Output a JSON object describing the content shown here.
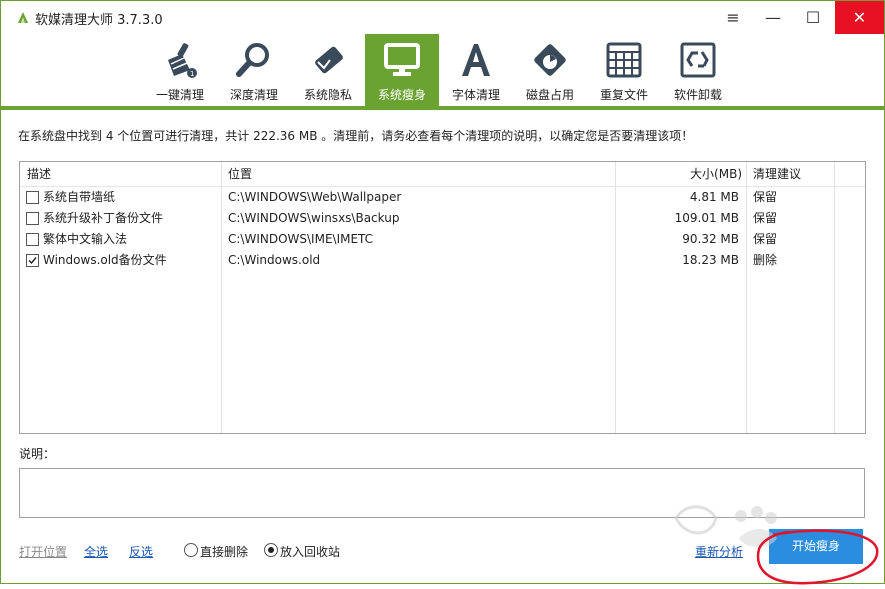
{
  "app": {
    "title": "软媒清理大师 3.7.3.0"
  },
  "window_controls": {
    "menu": "≡",
    "minimize": "—",
    "maximize": "☐",
    "close": "✕"
  },
  "toolbar": {
    "items": [
      {
        "label": "一键清理",
        "icon": "broom-icon"
      },
      {
        "label": "深度清理",
        "icon": "magnifier-icon"
      },
      {
        "label": "系统隐私",
        "icon": "eraser-icon"
      },
      {
        "label": "系统瘦身",
        "icon": "monitor-icon"
      },
      {
        "label": "字体清理",
        "icon": "font-icon"
      },
      {
        "label": "磁盘占用",
        "icon": "disk-icon"
      },
      {
        "label": "重复文件",
        "icon": "grid-icon"
      },
      {
        "label": "软件卸载",
        "icon": "recycle-icon"
      }
    ],
    "active_index": 3,
    "accent": "#6aa331"
  },
  "info_text": "在系统盘中找到 4 个位置可进行清理，共计 222.36 MB 。清理前，请务必查看每个清理项的说明，以确定您是否要清理该项！",
  "table": {
    "headers": {
      "desc": "描述",
      "location": "位置",
      "size": "大小(MB)",
      "advice": "清理建议"
    },
    "rows": [
      {
        "checked": false,
        "desc": "系统自带墙纸",
        "location": "C:\\WINDOWS\\Web\\Wallpaper",
        "size": "4.81 MB",
        "advice": "保留"
      },
      {
        "checked": false,
        "desc": "系统升级补丁备份文件",
        "location": "C:\\WINDOWS\\winsxs\\Backup",
        "size": "109.01 MB",
        "advice": "保留"
      },
      {
        "checked": false,
        "desc": "繁体中文输入法",
        "location": "C:\\WINDOWS\\IME\\IMETC",
        "size": "90.32 MB",
        "advice": "保留"
      },
      {
        "checked": true,
        "desc": "Windows.old备份文件",
        "location": "C:\\Windows.old",
        "size": "18.23 MB",
        "advice": "删除"
      }
    ]
  },
  "description_label": "说明：",
  "bottom": {
    "open_location": "打开位置",
    "select_all": "全选",
    "invert": "反选",
    "direct_delete": "直接删除",
    "to_recycle": "放入回收站",
    "recycle_selected": true,
    "reanalyze": "重新分析",
    "start": "开始瘦身"
  },
  "colors": {
    "close_bg": "#e81123",
    "start_bg": "#2b8de0",
    "link": "#1a56b3",
    "annotation": "#e0142a"
  }
}
